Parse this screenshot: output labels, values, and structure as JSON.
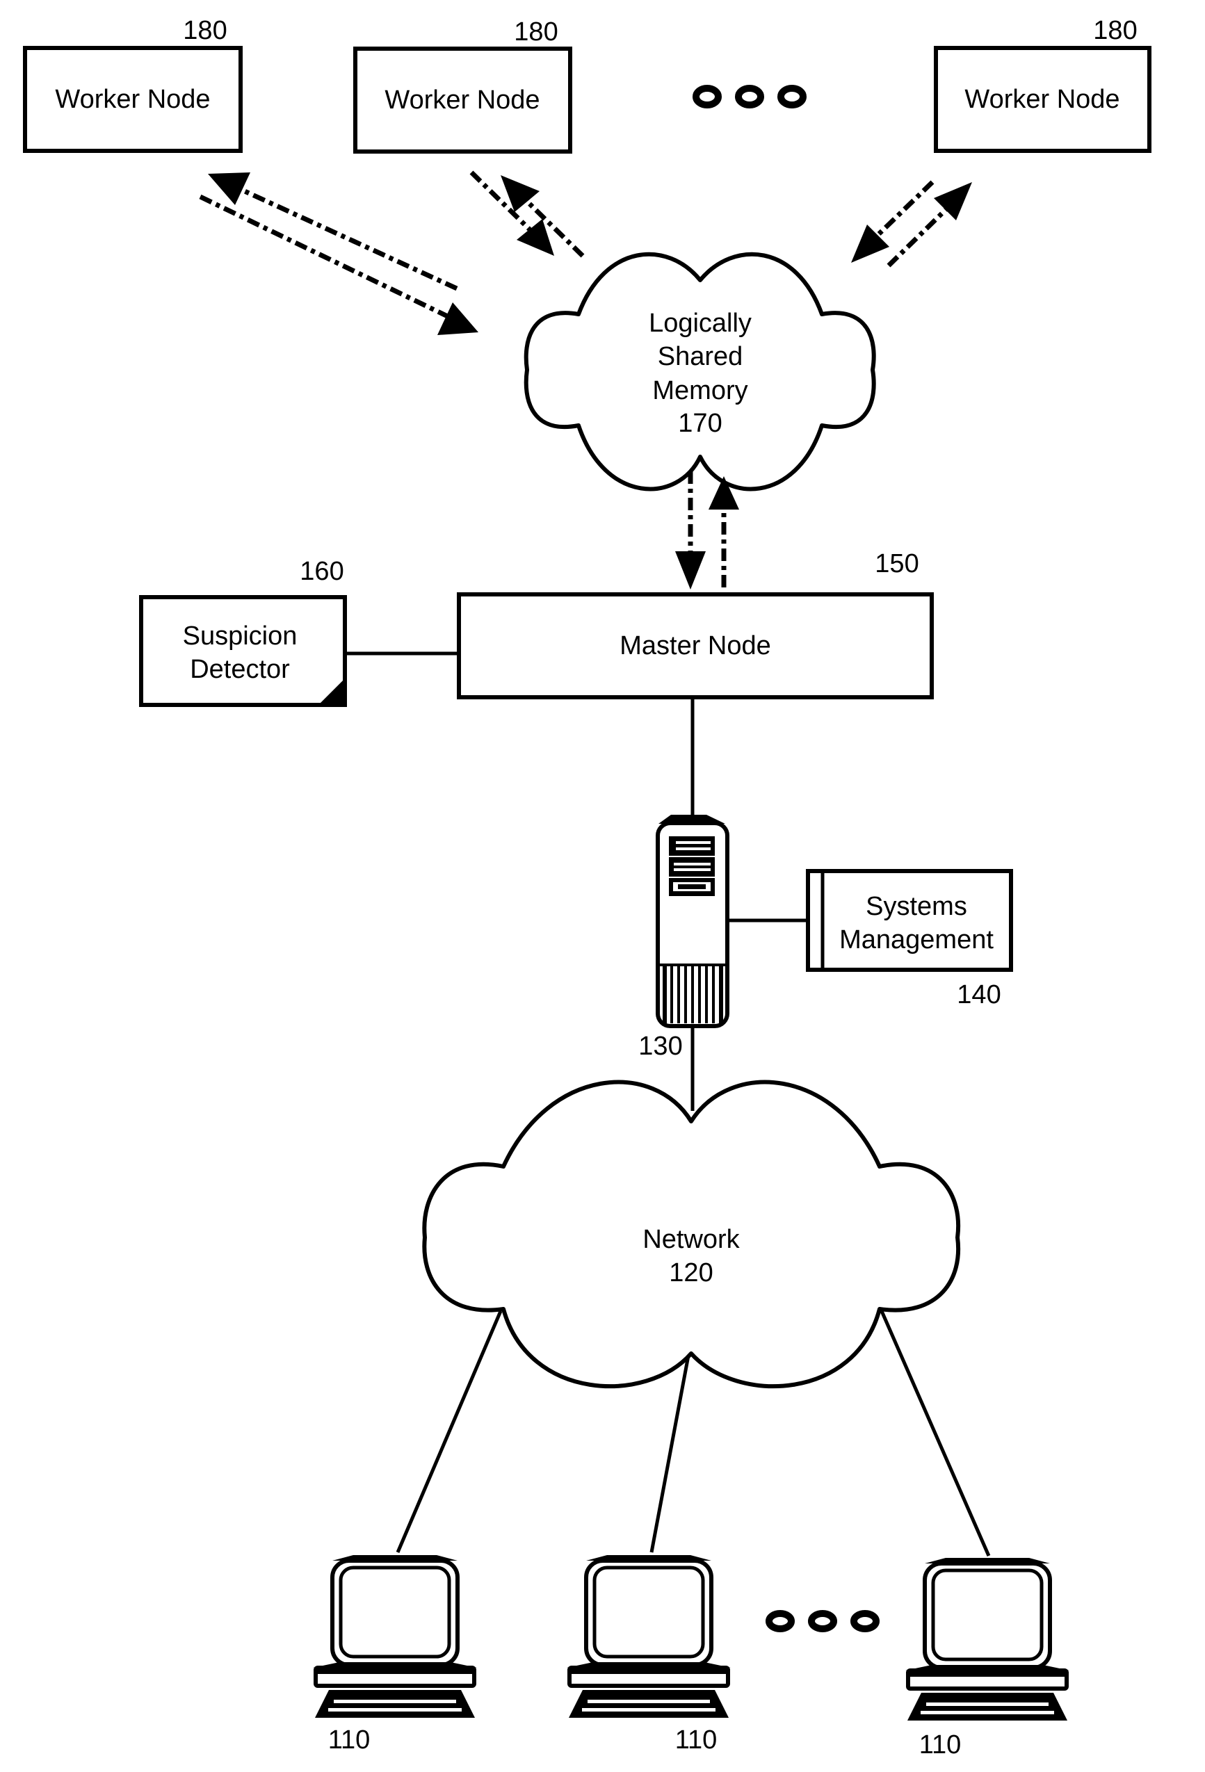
{
  "figure": {
    "worker_nodes": [
      {
        "label": "Worker Node",
        "ref": "180"
      },
      {
        "label": "Worker Node",
        "ref": "180"
      },
      {
        "label": "Worker Node",
        "ref": "180"
      }
    ],
    "shared_memory": {
      "lines": [
        "Logically",
        "Shared",
        "Memory",
        "170"
      ]
    },
    "master_node": {
      "label": "Master Node",
      "ref": "150"
    },
    "suspicion_detector": {
      "lines": [
        "Suspicion",
        "Detector"
      ],
      "ref": "160"
    },
    "server": {
      "ref": "130",
      "icon": "server-tower-icon"
    },
    "systems_management": {
      "lines": [
        "Systems",
        "Management"
      ],
      "ref": "140"
    },
    "network": {
      "lines": [
        "Network",
        "120"
      ]
    },
    "clients": [
      {
        "ref": "110",
        "icon": "computer-terminal-icon"
      },
      {
        "ref": "110",
        "icon": "computer-terminal-icon"
      },
      {
        "ref": "110",
        "icon": "computer-terminal-icon"
      }
    ],
    "ellipsis_icon": "ellipsis-icon",
    "colors": {
      "stroke": "#000000",
      "background": "#ffffff"
    }
  }
}
